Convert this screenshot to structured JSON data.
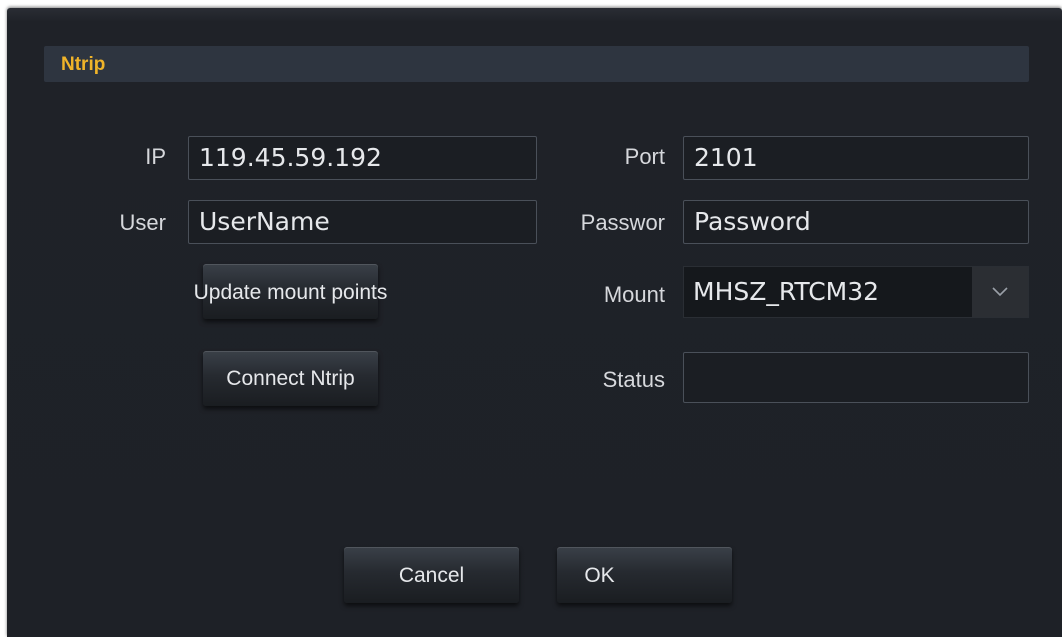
{
  "dialog": {
    "title": "Ntrip"
  },
  "form": {
    "ip_label": "IP",
    "ip_value": "119.45.59.192",
    "port_label": "Port",
    "port_value": "2101",
    "user_label": "User",
    "user_value": "UserName",
    "password_label": "Passwor",
    "password_value": "Password",
    "update_button_label": "Update mount points",
    "mount_label": "Mount",
    "mount_value": "MHSZ_RTCM32",
    "connect_button_label": "Connect Ntrip",
    "status_label": "Status",
    "status_value": ""
  },
  "footer": {
    "cancel_label": "Cancel",
    "ok_label": "OK"
  },
  "colors": {
    "title_accent": "#f0b429",
    "background": "#1e2127"
  },
  "icons": {
    "dropdown": "chevron-down-icon"
  }
}
